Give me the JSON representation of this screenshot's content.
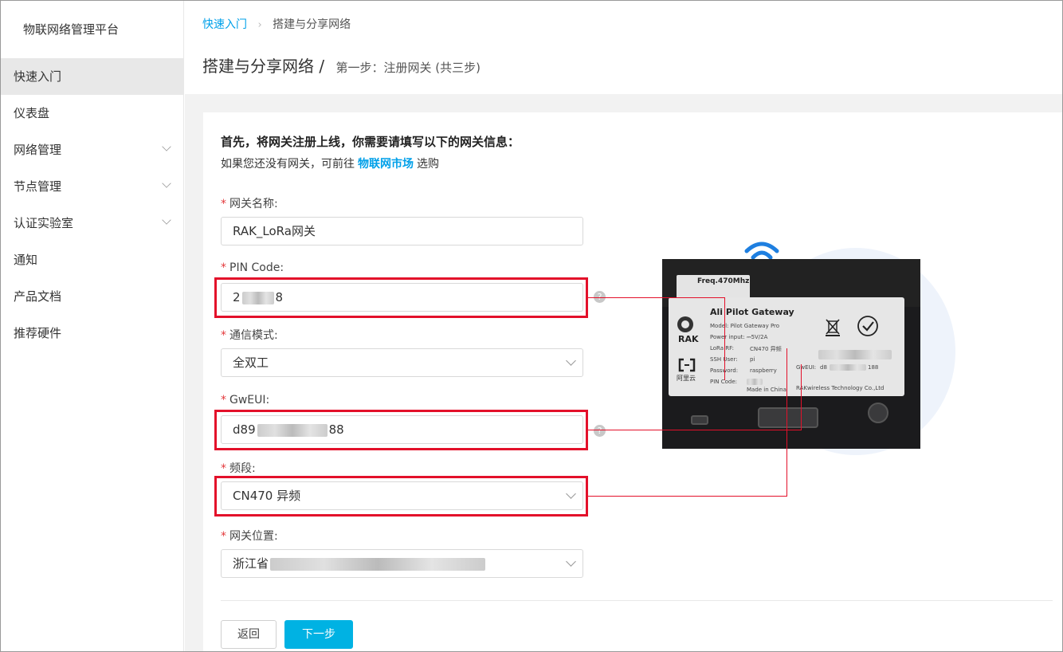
{
  "sidebar": {
    "brand": "物联网络管理平台",
    "items": [
      {
        "label": "快速入门",
        "active": true,
        "expandable": false
      },
      {
        "label": "仪表盘",
        "active": false,
        "expandable": false
      },
      {
        "label": "网络管理",
        "active": false,
        "expandable": true
      },
      {
        "label": "节点管理",
        "active": false,
        "expandable": true
      },
      {
        "label": "认证实验室",
        "active": false,
        "expandable": true
      },
      {
        "label": "通知",
        "active": false,
        "expandable": false
      },
      {
        "label": "产品文档",
        "active": false,
        "expandable": false
      },
      {
        "label": "推荐硬件",
        "active": false,
        "expandable": false
      }
    ]
  },
  "header": {
    "breadcrumb_link": "快速入门",
    "breadcrumb_sep": "›",
    "breadcrumb_current": "搭建与分享网络",
    "title": "搭建与分享网络 /",
    "subtitle": "第一步：注册网关 (共三步)"
  },
  "form": {
    "intro_title": "首先，将网关注册上线，你需要请填写以下的网关信息：",
    "intro_prefix": "如果您还没有网关，可前往",
    "intro_link": "物联网市场",
    "intro_suffix": "选购",
    "required_mark": "*",
    "help_glyph": "?",
    "gateway_name": {
      "label": "网关名称:",
      "value": "RAK_LoRa网关"
    },
    "pin_code": {
      "label": "PIN Code:",
      "value_start": "2",
      "value_end": "8"
    },
    "comm_mode": {
      "label": "通信模式:",
      "value": "全双工"
    },
    "gweui": {
      "label": "GwEUI:",
      "value_start": "d89",
      "value_end": "88"
    },
    "band": {
      "label": "频段:",
      "value": "CN470 异频"
    },
    "location": {
      "label": "网关位置:",
      "value_start": "浙江省"
    }
  },
  "buttons": {
    "back": "返回",
    "next": "下一步"
  },
  "photo": {
    "freq_label": "Freq.470Mhz",
    "title": "Ali Pilot Gateway",
    "rak": "RAK",
    "aliyun": "阿里云",
    "model": "Model: Pilot Gateway Pro",
    "power": "Power input: ⎓5V/2A",
    "lora_rf": "LoRa RF:",
    "lora_rf_val": "CN470 异频",
    "ssh_user": "SSH User:",
    "ssh_user_val": "pi",
    "password": "Password:",
    "password_val": "raspberry",
    "pin": "PIN Code:",
    "gweui": "GwEUI:",
    "gweui_val_start": "d8",
    "gweui_val_end": "188",
    "made_in": "Made in China",
    "maker": "RAKwireless Technology Co.,Ltd"
  },
  "colors": {
    "accent": "#00a0e9",
    "primary_button": "#00b2e3",
    "highlight": "#e3102a",
    "required": "#e3393c"
  }
}
